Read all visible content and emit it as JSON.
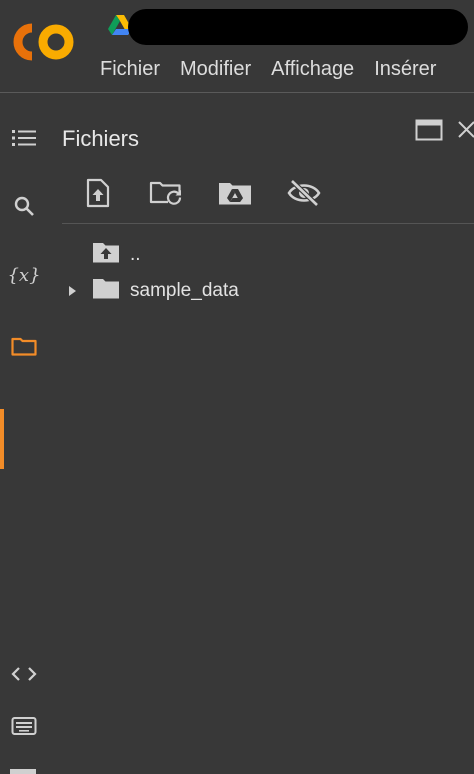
{
  "app": {
    "logo_text": "CO",
    "menu": [
      "Fichier",
      "Modifier",
      "Affichage",
      "Insérer"
    ]
  },
  "sidebar": {
    "title": "Fichiers",
    "rail_items": [
      {
        "name": "table-of-contents",
        "icon": "list-icon"
      },
      {
        "name": "search",
        "icon": "search-icon"
      },
      {
        "name": "variables",
        "icon": "variables-icon",
        "label": "{x}"
      },
      {
        "name": "files",
        "icon": "folder-icon",
        "active": true
      },
      {
        "name": "code-snippets",
        "icon": "code-icon"
      },
      {
        "name": "command-palette",
        "icon": "keyboard-icon"
      }
    ],
    "toolbar": [
      "upload-file-icon",
      "refresh-folder-icon",
      "mount-drive-icon",
      "hide-hidden-files-icon"
    ],
    "tree": [
      {
        "label": "..",
        "icon": "folder-up-icon"
      },
      {
        "label": "sample_data",
        "icon": "folder-icon",
        "expandable": true
      }
    ]
  },
  "colors": {
    "accent": "#f28c28",
    "background": "#383838",
    "text": "#e3e3e3",
    "logo_orange": "#f9ab00",
    "logo_dark_orange": "#e8710a"
  }
}
